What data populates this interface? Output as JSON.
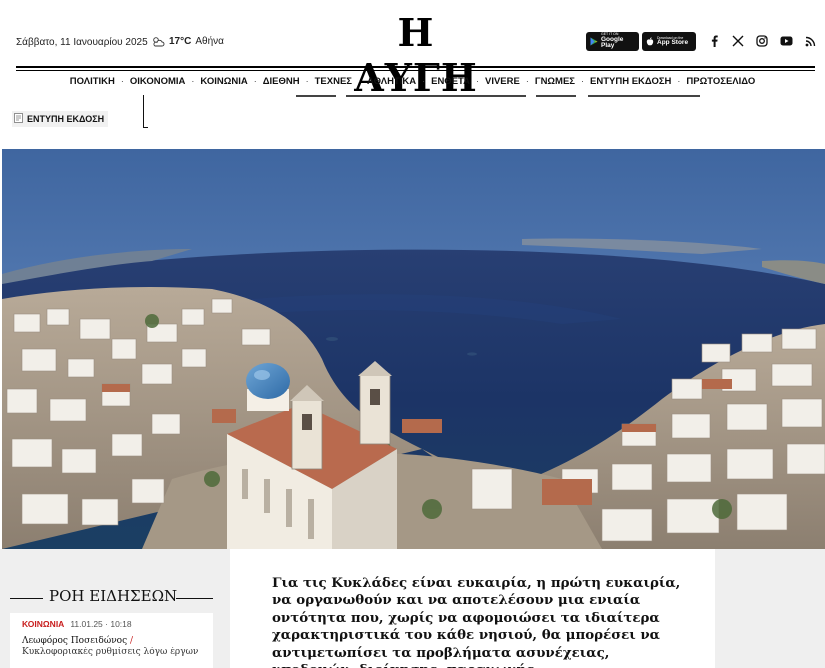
{
  "header": {
    "date": "Σάββατο, 11 Ιανουαρίου 2025",
    "weather": {
      "temperature": "17°C",
      "city": "Αθήνα",
      "icon": "partly-cloudy-icon"
    },
    "logo": "Η ΑΥΓΗ",
    "stores": [
      {
        "small": "GET IT ON",
        "name": "Google Play",
        "icon": "google-play-icon"
      },
      {
        "small": "Download on the",
        "name": "App Store",
        "icon": "apple-icon"
      }
    ],
    "social": [
      "facebook-icon",
      "x-icon",
      "instagram-icon",
      "youtube-icon",
      "rss-icon"
    ]
  },
  "nav": {
    "items": [
      "ΠΟΛΙΤΙΚΗ",
      "ΟΙΚΟΝΟΜΙΑ",
      "ΚΟΙΝΩΝΙΑ",
      "ΔΙΕΘΝΗ",
      "ΤΕΧΝΕΣ",
      "ΑΘΛΗΤΙΚΑ",
      "ΕΝΘΕΤΑ",
      "VIVERE",
      "ΓΝΩΜΕΣ",
      "ΕΝΤΥΠΗ ΕΚΔΟΣΗ",
      "ΠΡΩΤΟΣΕΛΙΔΟ"
    ]
  },
  "print_edition": {
    "label": "ΕΝΤΥΠΗ ΕΚΔΟΣΗ"
  },
  "news_feed": {
    "title": "ΡΟΗ ΕΙΔΗΣΕΩΝ",
    "items": [
      {
        "category": "ΚΟΙΝΩΝΙΑ",
        "datetime": "11.01.25 · 10:18",
        "headline": "Λεωφόρος Ποσειδώνος",
        "subtitle": "Κυκλοφοριακές ρυθμίσεις λόγω έργων - Μέχρι ποια ώρα θα ισχύσουν"
      }
    ]
  },
  "article": {
    "lead": "Για τις Κυκλάδες είναι ευκαιρία, η πρώτη ευκαιρία, να οργανωθούν και να αποτελέσουν μια ενιαία οντότητα που, χωρίς να αφομοιώσει τα ιδιαίτερα χαρακτηριστικά του κάθε νησιού, θα μπορέσει να αντιμετωπίσει τα προβλήματα ασυνέχειας, υποδομών, διοίκησης, παραγωγής"
  },
  "colors": {
    "accent_red": "#c81e1e",
    "sea": "#1d3d74",
    "sky": "#4c72a8",
    "page_grey": "#efefef"
  }
}
